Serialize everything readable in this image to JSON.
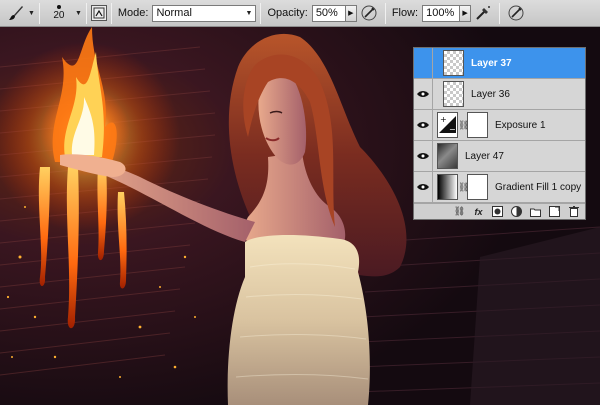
{
  "options_bar": {
    "tool_icon": "brush-icon",
    "brush_size": "20",
    "mode_label": "Mode:",
    "mode_value": "Normal",
    "opacity_label": "Opacity:",
    "opacity_value": "50%",
    "flow_label": "Flow:",
    "flow_value": "100%"
  },
  "layers": [
    {
      "name": "Layer 37",
      "selected": true,
      "visible": false,
      "thumb": "transparent"
    },
    {
      "name": "Layer 36",
      "selected": false,
      "visible": true,
      "thumb": "transparent"
    },
    {
      "name": "Exposure 1",
      "selected": false,
      "visible": true,
      "thumb": "adjustment-with-mask"
    },
    {
      "name": "Layer 47",
      "selected": false,
      "visible": true,
      "thumb": "photo"
    },
    {
      "name": "Gradient Fill 1 copy",
      "selected": false,
      "visible": true,
      "thumb": "gradient-with-mask"
    }
  ],
  "colors": {
    "selected_layer": "#3d93ec",
    "panel_bg": "#d6d6d6",
    "fire": "#ff8a1a"
  }
}
